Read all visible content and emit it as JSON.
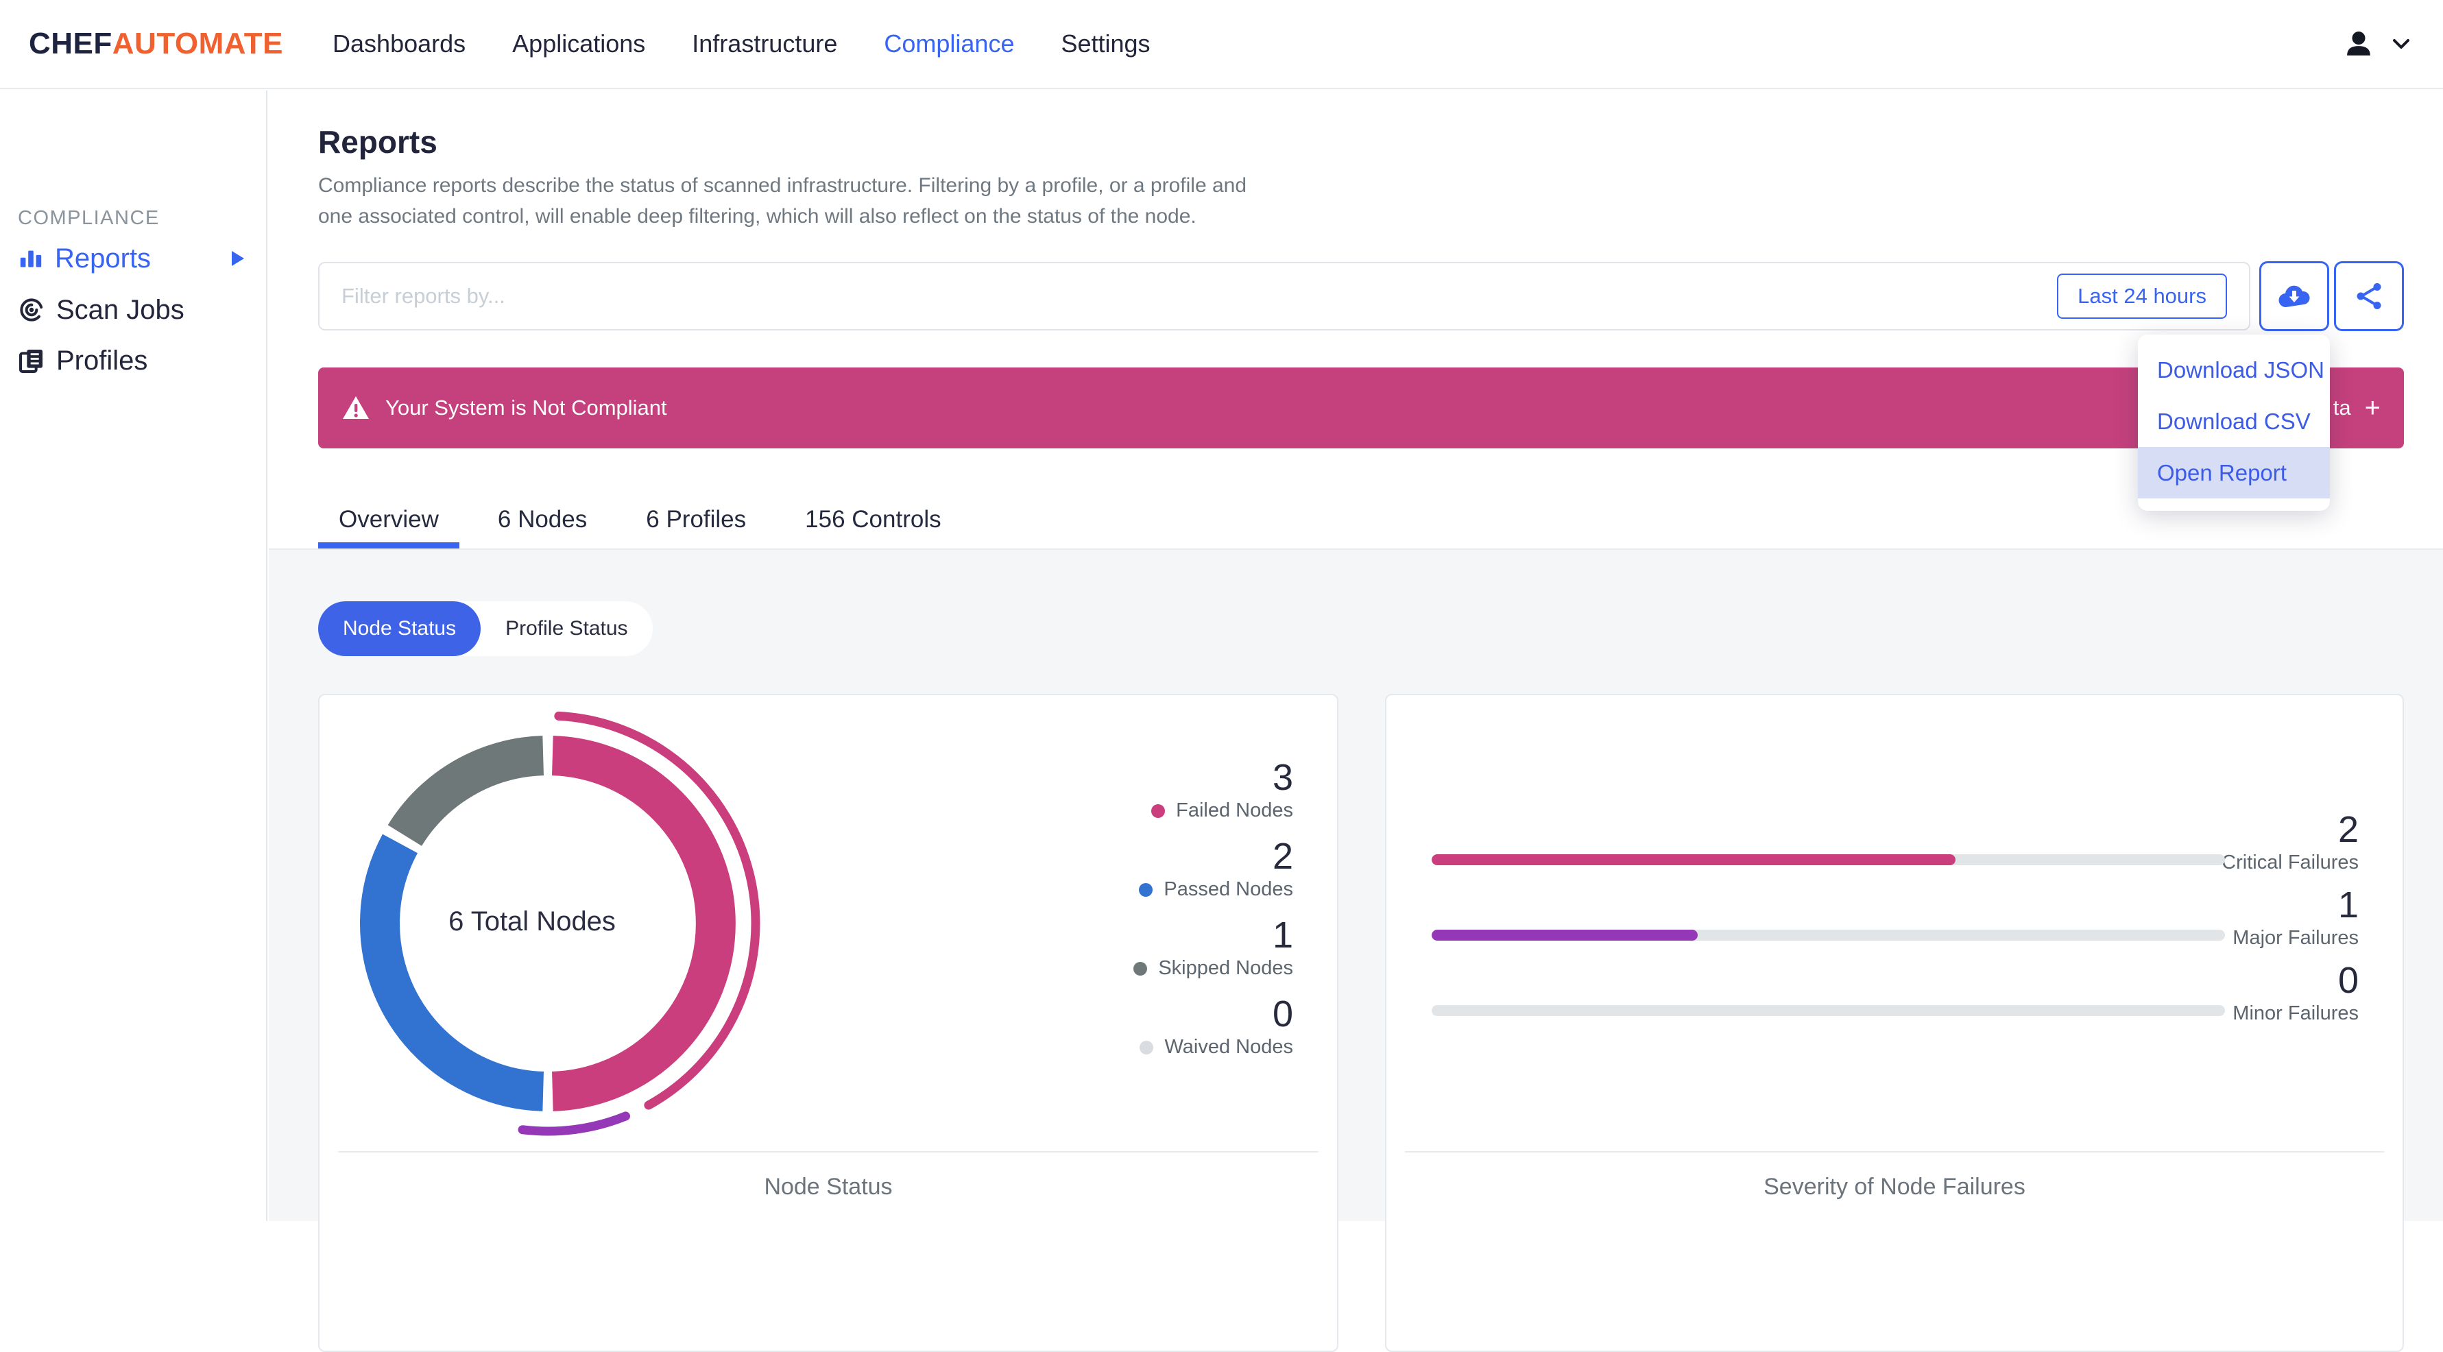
{
  "brand": {
    "chef": "CHEF",
    "automate": "AUTOMATE"
  },
  "nav": {
    "items": [
      {
        "label": "Dashboards",
        "active": false
      },
      {
        "label": "Applications",
        "active": false
      },
      {
        "label": "Infrastructure",
        "active": false
      },
      {
        "label": "Compliance",
        "active": true
      },
      {
        "label": "Settings",
        "active": false
      }
    ]
  },
  "sidebar": {
    "section": "COMPLIANCE",
    "items": [
      {
        "label": "Reports",
        "active": true
      },
      {
        "label": "Scan Jobs",
        "active": false
      },
      {
        "label": "Profiles",
        "active": false
      }
    ]
  },
  "page": {
    "title": "Reports",
    "description_line1": "Compliance reports describe the status of scanned infrastructure. Filtering by a profile, or a profile and",
    "description_line2": "one associated control, will enable deep filtering, which will also reflect on the status of the node."
  },
  "filter": {
    "placeholder": "Filter reports by...",
    "time_range": "Last 24 hours"
  },
  "banner": {
    "text": "Your System is Not Compliant",
    "fragment": "ta",
    "plus": "+"
  },
  "download_menu": {
    "items": [
      "Download JSON",
      "Download CSV",
      "Open Report"
    ],
    "highlighted": "Open Report"
  },
  "tabs": [
    {
      "label": "Overview",
      "active": true
    },
    {
      "label": "6 Nodes",
      "active": false
    },
    {
      "label": "6 Profiles",
      "active": false
    },
    {
      "label": "156 Controls",
      "active": false
    }
  ],
  "toggle": {
    "options": [
      {
        "label": "Node Status",
        "active": true
      },
      {
        "label": "Profile Status",
        "active": false
      }
    ]
  },
  "colors": {
    "primary_blue": "#3864f2",
    "brand_orange": "#f0612f",
    "banner_pink": "#c5417d",
    "menu_highlight": "#d8ddf6",
    "content_bg": "#f4f6f8"
  },
  "chart_data": [
    {
      "type": "pie",
      "variant": "donut",
      "title": "Node Status",
      "center_label": "6 Total Nodes",
      "total": 6,
      "segments": [
        {
          "label": "Failed Nodes",
          "value": 3,
          "color": "#cb3e7e"
        },
        {
          "label": "Passed Nodes",
          "value": 2,
          "color": "#3272d0"
        },
        {
          "label": "Skipped Nodes",
          "value": 1,
          "color": "#6f7878"
        },
        {
          "label": "Waived Nodes",
          "value": 0,
          "color": "#d9dde1"
        }
      ],
      "accent_arcs": [
        {
          "start_deg": 3,
          "end_deg": 151,
          "color": "#cb3e7e"
        },
        {
          "start_deg": 158,
          "end_deg": 187,
          "color": "#9438b8"
        }
      ],
      "legend_position": "right"
    },
    {
      "type": "bar",
      "orientation": "horizontal",
      "title": "Severity of Node Failures",
      "bars": [
        {
          "label": "Critical Failures",
          "value": 2,
          "fill_pct": 66,
          "color": "#cb3e7e"
        },
        {
          "label": "Major Failures",
          "value": 1,
          "fill_pct": 33.5,
          "color": "#9438b8"
        },
        {
          "label": "Minor Failures",
          "value": 0,
          "fill_pct": 0,
          "color": "#9438b8"
        }
      ],
      "max_value": 3,
      "track_color": "#e2e5e8"
    }
  ]
}
